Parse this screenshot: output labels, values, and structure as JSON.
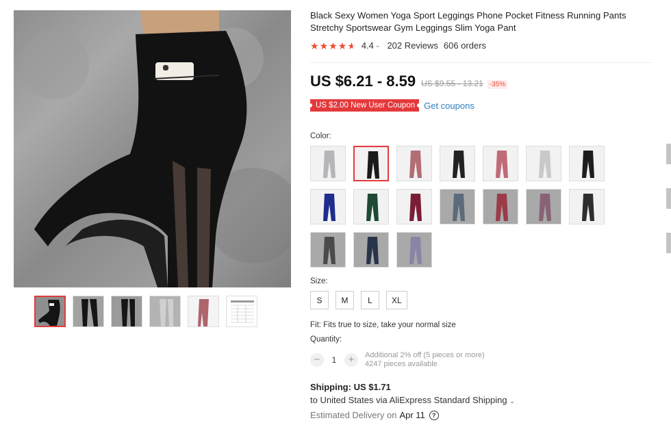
{
  "product": {
    "title": "Black Sexy Women Yoga Sport Leggings Phone Pocket Fitness Running Pants Stretchy Sportswear Gym Leggings Slim Yoga Pant",
    "rating": "4.4",
    "rating_chevron": "⌄",
    "reviews": "202 Reviews",
    "orders": "606 orders",
    "stars_filled": 4.5
  },
  "price": {
    "current": "US $6.21 - 8.59",
    "original": "US $9.55 - 13.21",
    "discount": "-35%"
  },
  "coupon": {
    "label": "US $2.00 New User Coupon",
    "link": "Get coupons"
  },
  "color": {
    "label": "Color:",
    "swatches": [
      {
        "name": "gray-mesh",
        "color": "#b5b5bb"
      },
      {
        "name": "black-mesh",
        "color": "#1a1a1a",
        "active": true
      },
      {
        "name": "rose",
        "color": "#b26e73"
      },
      {
        "name": "black-pocket",
        "color": "#222222"
      },
      {
        "name": "pink",
        "color": "#c16a78"
      },
      {
        "name": "light-gray",
        "color": "#c9c9c9"
      },
      {
        "name": "black",
        "color": "#1d1d1d"
      },
      {
        "name": "royal-blue",
        "color": "#1f2d8f"
      },
      {
        "name": "dark-green",
        "color": "#1f4a35"
      },
      {
        "name": "burgundy",
        "color": "#7a1e36"
      },
      {
        "name": "blue-gray",
        "color": "#5b6b7c"
      },
      {
        "name": "wine-red",
        "color": "#9b3b48"
      },
      {
        "name": "mauve",
        "color": "#8a6276"
      },
      {
        "name": "charcoal",
        "color": "#2e2e2e"
      },
      {
        "name": "dark-gray",
        "color": "#4a4a4a"
      },
      {
        "name": "navy",
        "color": "#28344a"
      },
      {
        "name": "lavender",
        "color": "#8a84a6"
      }
    ]
  },
  "size": {
    "label": "Size:",
    "options": [
      "S",
      "M",
      "L",
      "XL"
    ]
  },
  "fit": "Fit: Fits true to size, take your normal size",
  "quantity": {
    "label": "Quantity:",
    "minus": "−",
    "value": "1",
    "plus": "+",
    "note1": "Additional 2% off (5 pieces or more)",
    "note2": "4247 pieces available"
  },
  "shipping": {
    "label": "Shipping:",
    "cost": "US $1.71",
    "route": "to United States via AliExpress Standard Shipping",
    "chevron": "⌄",
    "delivery_label": "Estimated Delivery on",
    "delivery_date": "Apr 11",
    "help": "?"
  },
  "colors": {
    "accent": "#e4393c",
    "link": "#2b7fbf",
    "star": "#f04a2f"
  }
}
